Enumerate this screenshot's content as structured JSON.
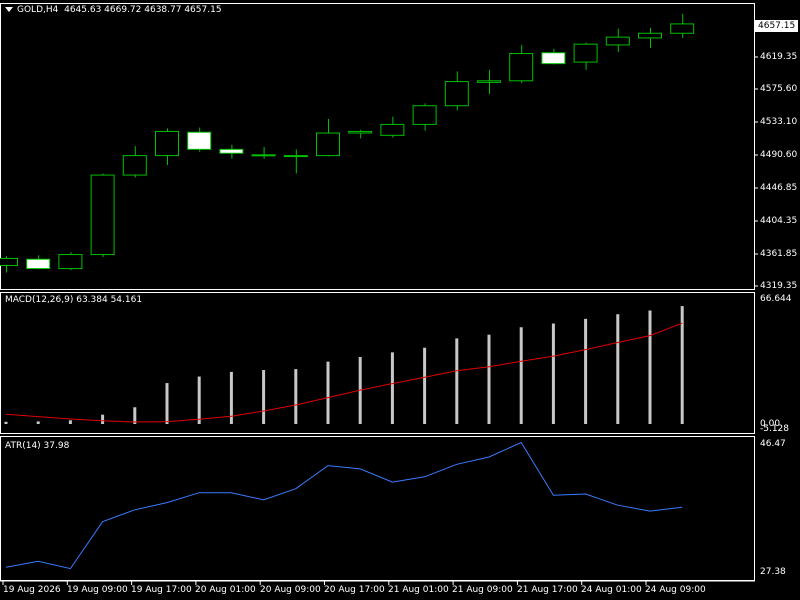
{
  "header": {
    "menu_icon": "triangle-down-icon",
    "symbol": "GOLD,H4",
    "ohlc": "4645.63 4669.72 4638.77 4657.15"
  },
  "current_price": "4657.15",
  "price_axis": [
    "4619.35",
    "4575.60",
    "4533.10",
    "4490.60",
    "4446.85",
    "4404.35",
    "4361.85",
    "4319.35"
  ],
  "macd": {
    "label": "MACD(12,26,9) 63.384 54.161",
    "axis_top": "66.644",
    "axis_zero": "0.00",
    "axis_bottom": "-5.128"
  },
  "atr": {
    "label": "ATR(14) 37.98",
    "axis_top": "46.47",
    "axis_bottom": "27.38"
  },
  "time_axis": [
    "19 Aug 2026",
    "19 Aug 09:00",
    "19 Aug 17:00",
    "20 Aug 01:00",
    "20 Aug 09:00",
    "20 Aug 17:00",
    "21 Aug 01:00",
    "21 Aug 09:00",
    "21 Aug 17:00",
    "24 Aug 01:00",
    "24 Aug 09:00"
  ],
  "colors": {
    "bull": "#00c000",
    "bear_fill": "#ffffff",
    "signal": "#e00000",
    "atr": "#3a7bff",
    "hist": "#c8c8c8",
    "frame": "#ffffff"
  },
  "chart_data": [
    {
      "type": "candlestick",
      "title": "GOLD,H4",
      "ylim": [
        4319.35,
        4669.72
      ],
      "candles": [
        {
          "o": 4347,
          "h": 4359,
          "l": 4338,
          "c": 4356
        },
        {
          "o": 4355,
          "h": 4360,
          "l": 4342,
          "c": 4343
        },
        {
          "o": 4343,
          "h": 4364,
          "l": 4341,
          "c": 4361
        },
        {
          "o": 4361,
          "h": 4465,
          "l": 4358,
          "c": 4463
        },
        {
          "o": 4463,
          "h": 4500,
          "l": 4460,
          "c": 4488
        },
        {
          "o": 4488,
          "h": 4523,
          "l": 4476,
          "c": 4519
        },
        {
          "o": 4518,
          "h": 4524,
          "l": 4493,
          "c": 4496
        },
        {
          "o": 4496,
          "h": 4502,
          "l": 4484,
          "c": 4491
        },
        {
          "o": 4489,
          "h": 4499,
          "l": 4484,
          "c": 4488
        },
        {
          "o": 4487,
          "h": 4496,
          "l": 4465,
          "c": 4488
        },
        {
          "o": 4488,
          "h": 4535,
          "l": 4487,
          "c": 4517
        },
        {
          "o": 4517,
          "h": 4521,
          "l": 4510,
          "c": 4519
        },
        {
          "o": 4514,
          "h": 4538,
          "l": 4511,
          "c": 4528
        },
        {
          "o": 4528,
          "h": 4555,
          "l": 4520,
          "c": 4552
        },
        {
          "o": 4552,
          "h": 4596,
          "l": 4546,
          "c": 4583
        },
        {
          "o": 4582,
          "h": 4598,
          "l": 4567,
          "c": 4584
        },
        {
          "o": 4584,
          "h": 4630,
          "l": 4581,
          "c": 4619
        },
        {
          "o": 4620,
          "h": 4625,
          "l": 4605,
          "c": 4606
        },
        {
          "o": 4608,
          "h": 4633,
          "l": 4598,
          "c": 4631
        },
        {
          "o": 4630,
          "h": 4651,
          "l": 4621,
          "c": 4640
        },
        {
          "o": 4639,
          "h": 4652,
          "l": 4626,
          "c": 4645
        },
        {
          "o": 4645,
          "h": 4670,
          "l": 4639,
          "c": 4657
        }
      ]
    },
    {
      "type": "bar+line",
      "title": "MACD(12,26,9)",
      "ylim": [
        -5.128,
        66.644
      ],
      "histogram": [
        1.2,
        1.4,
        2.0,
        5.0,
        9.0,
        22.0,
        25.5,
        28.0,
        29.0,
        29.5,
        33.5,
        36.0,
        38.5,
        41.0,
        46.0,
        48.0,
        52.0,
        54.0,
        56.5,
        59.0,
        61.0,
        63.384
      ],
      "signal": [
        5.2,
        4.0,
        2.7,
        1.7,
        1.1,
        1.3,
        2.5,
        4.2,
        7.0,
        10.2,
        14.2,
        18.2,
        21.7,
        25.1,
        28.6,
        30.8,
        33.7,
        36.5,
        40.0,
        43.8,
        47.5,
        54.161
      ]
    },
    {
      "type": "line",
      "title": "ATR(14)",
      "ylim": [
        27.38,
        46.47
      ],
      "values": [
        28.1,
        29.0,
        27.9,
        35.0,
        36.8,
        37.9,
        39.4,
        39.4,
        38.3,
        40.0,
        43.5,
        43.0,
        41.0,
        41.8,
        43.7,
        44.8,
        47.0,
        39.0,
        39.2,
        37.5,
        36.6,
        37.2
      ]
    }
  ]
}
